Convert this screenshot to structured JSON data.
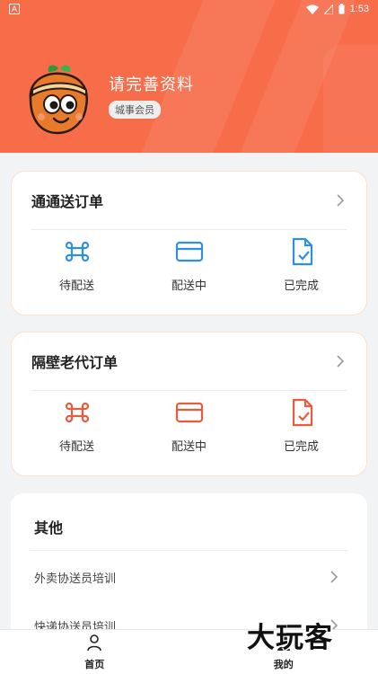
{
  "status_bar": {
    "left_badge": "A",
    "time": "1:53"
  },
  "header": {
    "nickname": "请完善资料",
    "member_level": "城事会员",
    "brand_color": "#f76d4a"
  },
  "order_cards": [
    {
      "title": "通通送订单",
      "accent": "#2f8ee6",
      "statuses": [
        {
          "label": "待配送",
          "icon": "command-icon"
        },
        {
          "label": "配送中",
          "icon": "card-icon"
        },
        {
          "label": "已完成",
          "icon": "file-check-icon"
        }
      ]
    },
    {
      "title": "隔壁老代订单",
      "accent": "#e85b3c",
      "statuses": [
        {
          "label": "待配送",
          "icon": "command-icon"
        },
        {
          "label": "配送中",
          "icon": "card-icon"
        },
        {
          "label": "已完成",
          "icon": "file-check-icon"
        }
      ]
    }
  ],
  "other": {
    "title": "其他",
    "items": [
      {
        "label": "外卖协送员培训"
      },
      {
        "label": "快递协送员培训"
      }
    ]
  },
  "bottom_nav": [
    {
      "label": "首页",
      "icon": "person-icon"
    },
    {
      "label": "我的",
      "icon": "user-icon"
    }
  ],
  "watermark": "大玩客"
}
